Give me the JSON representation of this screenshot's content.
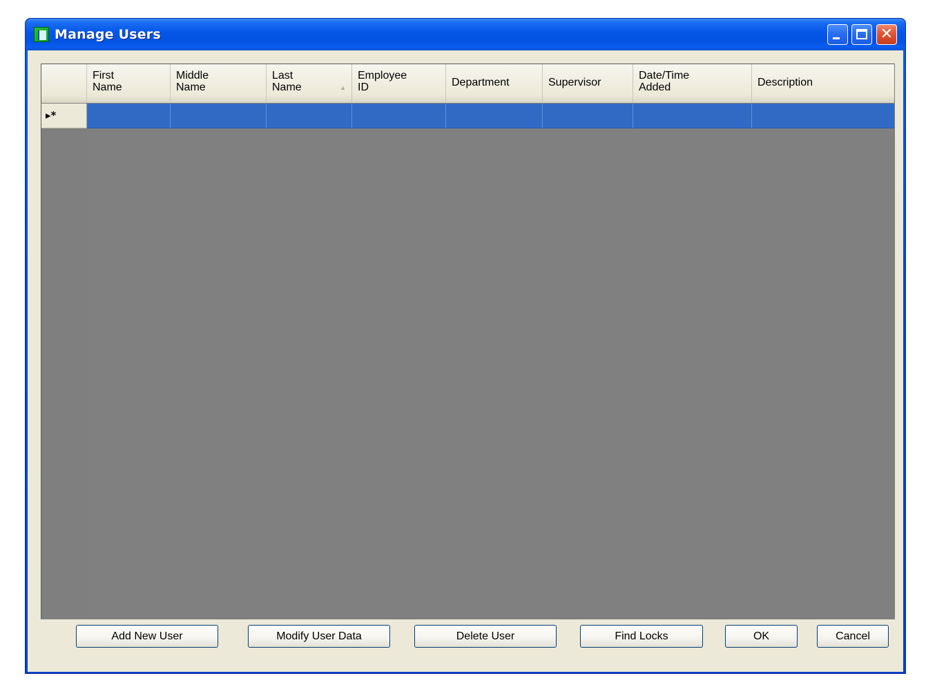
{
  "window": {
    "title": "Manage Users"
  },
  "grid": {
    "columns": [
      {
        "label": "First\nName"
      },
      {
        "label": "Middle\nName"
      },
      {
        "label": "Last\nName",
        "sorted": "ascending"
      },
      {
        "label": "Employee\nID"
      },
      {
        "label": "Department"
      },
      {
        "label": "Supervisor"
      },
      {
        "label": "Date/Time\nAdded"
      },
      {
        "label": "Description"
      }
    ],
    "new_row_marker": "▸*",
    "selection_color": "#316ac5",
    "background_color": "#808080"
  },
  "buttons": {
    "add": "Add New User",
    "modify": "Modify User Data",
    "delete": "Delete User",
    "find_locks": "Find Locks",
    "ok": "OK",
    "cancel": "Cancel"
  }
}
